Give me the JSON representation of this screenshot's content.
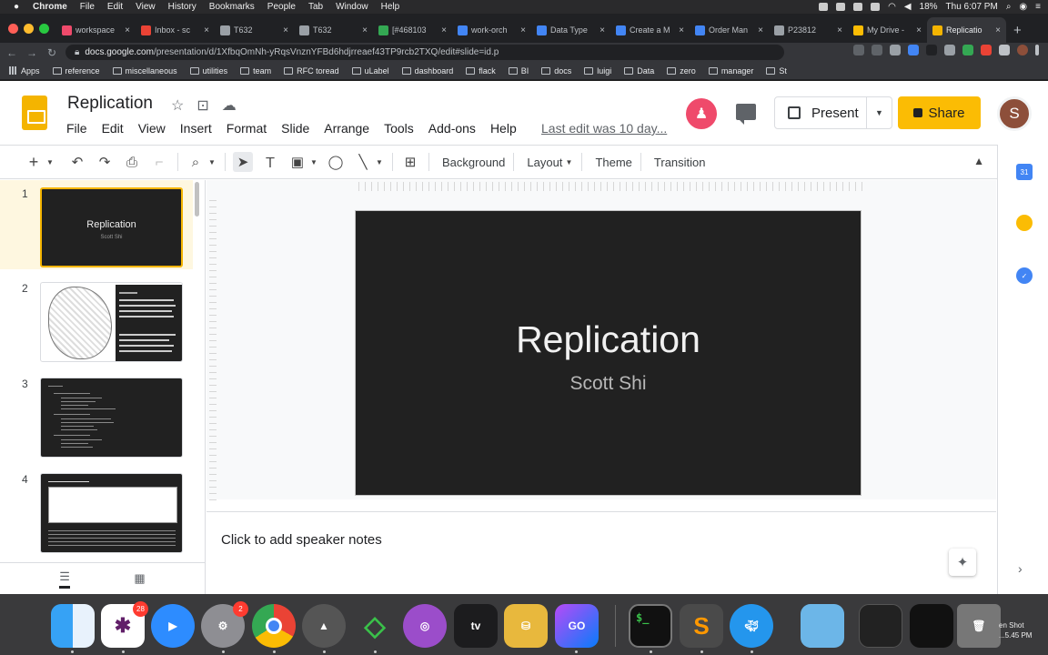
{
  "mac_menubar": {
    "app": "Chrome",
    "items": [
      "File",
      "Edit",
      "View",
      "History",
      "Bookmarks",
      "People",
      "Tab",
      "Window",
      "Help"
    ],
    "battery": "18%",
    "clock": "Thu 6:07 PM"
  },
  "browser": {
    "tabs": [
      {
        "title": "workspace",
        "favicon_color": "#ef4a6b"
      },
      {
        "title": "Inbox - sc",
        "favicon_color": "#ea4335"
      },
      {
        "title": "T632",
        "favicon_color": "#9aa0a6"
      },
      {
        "title": "T632",
        "favicon_color": "#9aa0a6"
      },
      {
        "title": "[#468103",
        "favicon_color": "#34a853"
      },
      {
        "title": "work-orch",
        "favicon_color": "#4285f4"
      },
      {
        "title": "Data Type",
        "favicon_color": "#4285f4"
      },
      {
        "title": "Create a M",
        "favicon_color": "#4285f4"
      },
      {
        "title": "Order Man",
        "favicon_color": "#4285f4"
      },
      {
        "title": "P23812",
        "favicon_color": "#9aa0a6"
      },
      {
        "title": "My Drive -",
        "favicon_color": "#fbbc04"
      },
      {
        "title": "Replicatio",
        "favicon_color": "#f4b400",
        "active": true
      }
    ],
    "url_host": "docs.google.com",
    "url_path": "/presentation/d/1XfbqOmNh-yRqsVnznYFBd6hdjrreaef43TP9rcb2TXQ/edit#slide=id.p",
    "bookmarks": [
      "Apps",
      "reference",
      "miscellaneous",
      "utilities",
      "team",
      "RFC toread",
      "uLabel",
      "dashboard",
      "flack",
      "BI",
      "docs",
      "luigi",
      "Data",
      "zero",
      "manager",
      "St"
    ]
  },
  "docs": {
    "title": "Replication",
    "menus": [
      "File",
      "Edit",
      "View",
      "Insert",
      "Format",
      "Slide",
      "Arrange",
      "Tools",
      "Add-ons",
      "Help"
    ],
    "last_edit": "Last edit was 10 day...",
    "present_label": "Present",
    "share_label": "Share",
    "avatar_initial": "S",
    "toolbar_text": {
      "background": "Background",
      "layout": "Layout",
      "theme": "Theme",
      "transition": "Transition"
    },
    "slides": [
      {
        "number": "1",
        "title": "Replication",
        "subtitle": "Scott Shi"
      },
      {
        "number": "2"
      },
      {
        "number": "3"
      },
      {
        "number": "4"
      }
    ],
    "main_slide": {
      "title": "Replication",
      "subtitle": "Scott Shi"
    },
    "speaker_notes_placeholder": "Click to add speaker notes",
    "calendar_day": "31"
  },
  "dock": {
    "slack_badge": "28",
    "prefs_badge": "2",
    "appletv_label": "tv",
    "goland_label": "GO",
    "screenshot_label": "en Shot",
    "screenshot_time": "...5.45 PM"
  }
}
